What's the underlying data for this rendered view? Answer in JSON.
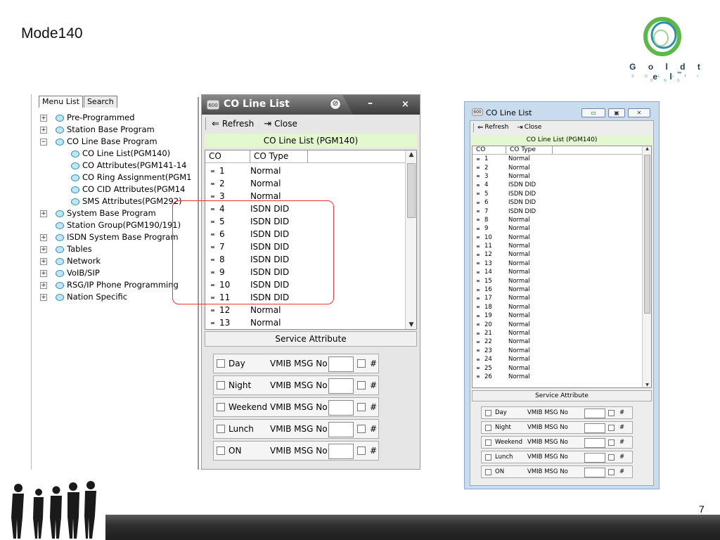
{
  "slide": {
    "title": "Mode140",
    "page_number": "7",
    "logo": {
      "brand": "G o l d t e l",
      "trademark": "™",
      "tagline": "S O L U T I O N S",
      "accent": "#5db84a"
    }
  },
  "tree_panel": {
    "tabs": [
      "Menu List",
      "Search"
    ],
    "items": [
      {
        "label": "Pre-Programmed",
        "level": 0,
        "expander": "+"
      },
      {
        "label": "Station Base Program",
        "level": 0,
        "expander": "+"
      },
      {
        "label": "CO Line Base Program",
        "level": 0,
        "expander": "−"
      },
      {
        "label": "CO Line List(PGM140)",
        "level": 1,
        "expander": ""
      },
      {
        "label": "CO Attributes(PGM141-14",
        "level": 1,
        "expander": ""
      },
      {
        "label": "CO Ring Assignment(PGM1",
        "level": 1,
        "expander": ""
      },
      {
        "label": "CO CID Attributes(PGM14",
        "level": 1,
        "expander": ""
      },
      {
        "label": "SMS Attributes(PGM292)",
        "level": 1,
        "expander": ""
      },
      {
        "label": "System Base Program",
        "level": 0,
        "expander": "+"
      },
      {
        "label": "Station Group(PGM190/191)",
        "level": 0,
        "expander": ""
      },
      {
        "label": "ISDN System Base Program",
        "level": 0,
        "expander": "+"
      },
      {
        "label": "Tables",
        "level": 0,
        "expander": "+"
      },
      {
        "label": "Network",
        "level": 0,
        "expander": "+"
      },
      {
        "label": "VoIB/SIP",
        "level": 0,
        "expander": "+"
      },
      {
        "label": "RSG/IP Phone Programming",
        "level": 0,
        "expander": "+"
      },
      {
        "label": "Nation Specific",
        "level": 0,
        "expander": "+"
      }
    ]
  },
  "main_window": {
    "title": "CO Line List",
    "title_icon": "600",
    "minimize": "–",
    "close": "×",
    "toolbar": {
      "refresh": "Refresh",
      "close": "Close"
    },
    "list_caption": "CO Line List (PGM140)",
    "columns": [
      "CO",
      "CO Type"
    ],
    "rows": [
      {
        "co": "1",
        "type": "Normal"
      },
      {
        "co": "2",
        "type": "Normal"
      },
      {
        "co": "3",
        "type": "Normal"
      },
      {
        "co": "4",
        "type": "ISDN DID"
      },
      {
        "co": "5",
        "type": "ISDN DID"
      },
      {
        "co": "6",
        "type": "ISDN DID"
      },
      {
        "co": "7",
        "type": "ISDN DID"
      },
      {
        "co": "8",
        "type": "ISDN DID"
      },
      {
        "co": "9",
        "type": "ISDN DID"
      },
      {
        "co": "10",
        "type": "ISDN DID"
      },
      {
        "co": "11",
        "type": "ISDN DID"
      },
      {
        "co": "12",
        "type": "Normal"
      },
      {
        "co": "13",
        "type": "Normal"
      }
    ],
    "service_header": "Service Attribute",
    "services": [
      {
        "label": "Day",
        "msg_label": "VMIB MSG No",
        "hash": "#"
      },
      {
        "label": "Night",
        "msg_label": "VMIB MSG No",
        "hash": "#"
      },
      {
        "label": "Weekend",
        "msg_label": "VMIB MSG No",
        "hash": "#"
      },
      {
        "label": "Lunch",
        "msg_label": "VMIB MSG No",
        "hash": "#"
      },
      {
        "label": "ON",
        "msg_label": "VMIB MSG No",
        "hash": "#"
      }
    ]
  },
  "right_window": {
    "title": "CO Line List",
    "title_icon": "600",
    "toolbar": {
      "refresh": "Refresh",
      "close": "Close"
    },
    "list_caption": "CO Line List (PGM140)",
    "columns": [
      "CO",
      "CO Type"
    ],
    "rows": [
      {
        "co": "1",
        "type": "Normal"
      },
      {
        "co": "2",
        "type": "Normal"
      },
      {
        "co": "3",
        "type": "Normal"
      },
      {
        "co": "4",
        "type": "ISDN DID"
      },
      {
        "co": "5",
        "type": "ISDN DID"
      },
      {
        "co": "6",
        "type": "ISDN DID"
      },
      {
        "co": "7",
        "type": "ISDN DID"
      },
      {
        "co": "8",
        "type": "Normal"
      },
      {
        "co": "9",
        "type": "Normal"
      },
      {
        "co": "10",
        "type": "Normal"
      },
      {
        "co": "11",
        "type": "Normal"
      },
      {
        "co": "12",
        "type": "Normal"
      },
      {
        "co": "13",
        "type": "Normal"
      },
      {
        "co": "14",
        "type": "Normal"
      },
      {
        "co": "15",
        "type": "Normal"
      },
      {
        "co": "16",
        "type": "Normal"
      },
      {
        "co": "17",
        "type": "Normal"
      },
      {
        "co": "18",
        "type": "Normal"
      },
      {
        "co": "19",
        "type": "Normal"
      },
      {
        "co": "20",
        "type": "Normal"
      },
      {
        "co": "21",
        "type": "Normal"
      },
      {
        "co": "22",
        "type": "Normal"
      },
      {
        "co": "23",
        "type": "Normal"
      },
      {
        "co": "24",
        "type": "Normal"
      },
      {
        "co": "25",
        "type": "Normal"
      },
      {
        "co": "26",
        "type": "Normal"
      }
    ],
    "service_header": "Service Attribute",
    "services": [
      {
        "label": "Day",
        "msg_label": "VMIB MSG No",
        "hash": "#"
      },
      {
        "label": "Night",
        "msg_label": "VMIB MSG No",
        "hash": "#"
      },
      {
        "label": "Weekend",
        "msg_label": "VMIB MSG No",
        "hash": "#"
      },
      {
        "label": "Lunch",
        "msg_label": "VMIB MSG No",
        "hash": "#"
      },
      {
        "label": "ON",
        "msg_label": "VMIB MSG No",
        "hash": "#"
      }
    ]
  }
}
